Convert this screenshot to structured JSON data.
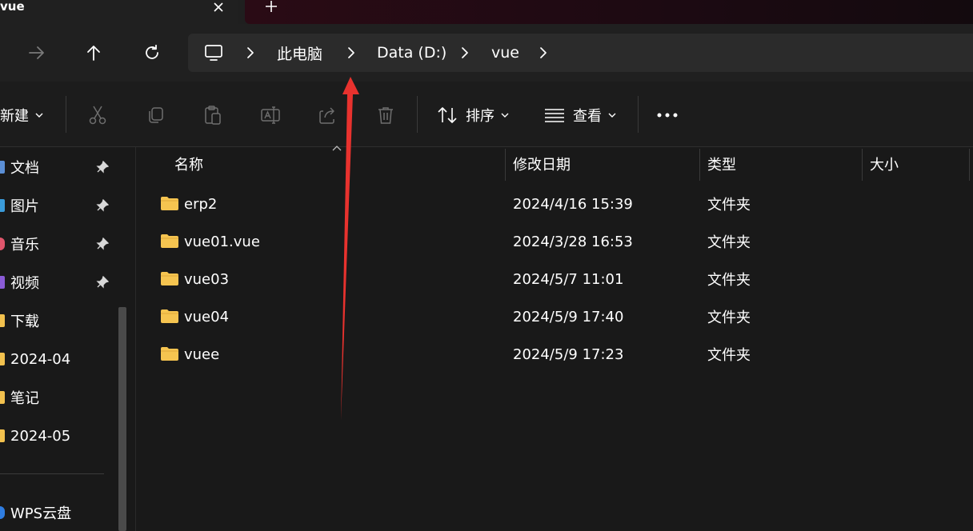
{
  "window": {
    "tab_title": "vue",
    "close_glyph": "✕",
    "new_tab_glyph": "+"
  },
  "nav": {
    "icons": [
      "forward-arrow-icon",
      "up-arrow-icon",
      "refresh-icon"
    ],
    "breadcrumb": [
      "此电脑",
      "Data (D:)",
      "vue"
    ]
  },
  "toolbar": {
    "new_label": "新建",
    "sort_label": "排序",
    "view_label": "查看",
    "more_label": "•••",
    "chevron": "⌄",
    "disabled_icons": [
      "cut-icon",
      "copy-icon",
      "paste-icon",
      "rename-icon",
      "share-icon",
      "delete-icon"
    ]
  },
  "sidebar": {
    "items": [
      {
        "label": "文档",
        "pinned": true,
        "icon_color": "#5b8fd6"
      },
      {
        "label": "图片",
        "pinned": true,
        "icon_color": "#3a9bd9"
      },
      {
        "label": "音乐",
        "pinned": true,
        "icon_color": "#e0566c"
      },
      {
        "label": "视频",
        "pinned": true,
        "icon_color": "#8a5bd6"
      },
      {
        "label": "下载",
        "pinned": false,
        "icon_color": "#f2c14e"
      },
      {
        "label": "2024-04",
        "pinned": false,
        "icon_color": "#f2c14e"
      },
      {
        "label": "笔记",
        "pinned": false,
        "icon_color": "#f2c14e"
      },
      {
        "label": "2024-05",
        "pinned": false,
        "icon_color": "#f2c14e"
      }
    ],
    "cloud_label": "WPS云盘",
    "cloud_color": "#2f7de1"
  },
  "list": {
    "headers": [
      "名称",
      "修改日期",
      "类型",
      "大小"
    ],
    "sort_glyph": "^",
    "rows": [
      {
        "name": "erp2",
        "modified": "2024/4/16 15:39",
        "type": "文件夹",
        "size": ""
      },
      {
        "name": "vue01.vue",
        "modified": "2024/3/28 16:53",
        "type": "文件夹",
        "size": ""
      },
      {
        "name": "vue03",
        "modified": "2024/5/7 11:01",
        "type": "文件夹",
        "size": ""
      },
      {
        "name": "vue04",
        "modified": "2024/5/9 17:40",
        "type": "文件夹",
        "size": ""
      },
      {
        "name": "vuee",
        "modified": "2024/5/9 17:23",
        "type": "文件夹",
        "size": ""
      }
    ]
  },
  "colors": {
    "folder": "#f5c450",
    "annotation_arrow": "#e8322e",
    "text": "#ffffff",
    "disabled_icon": "#6e6e6e"
  }
}
